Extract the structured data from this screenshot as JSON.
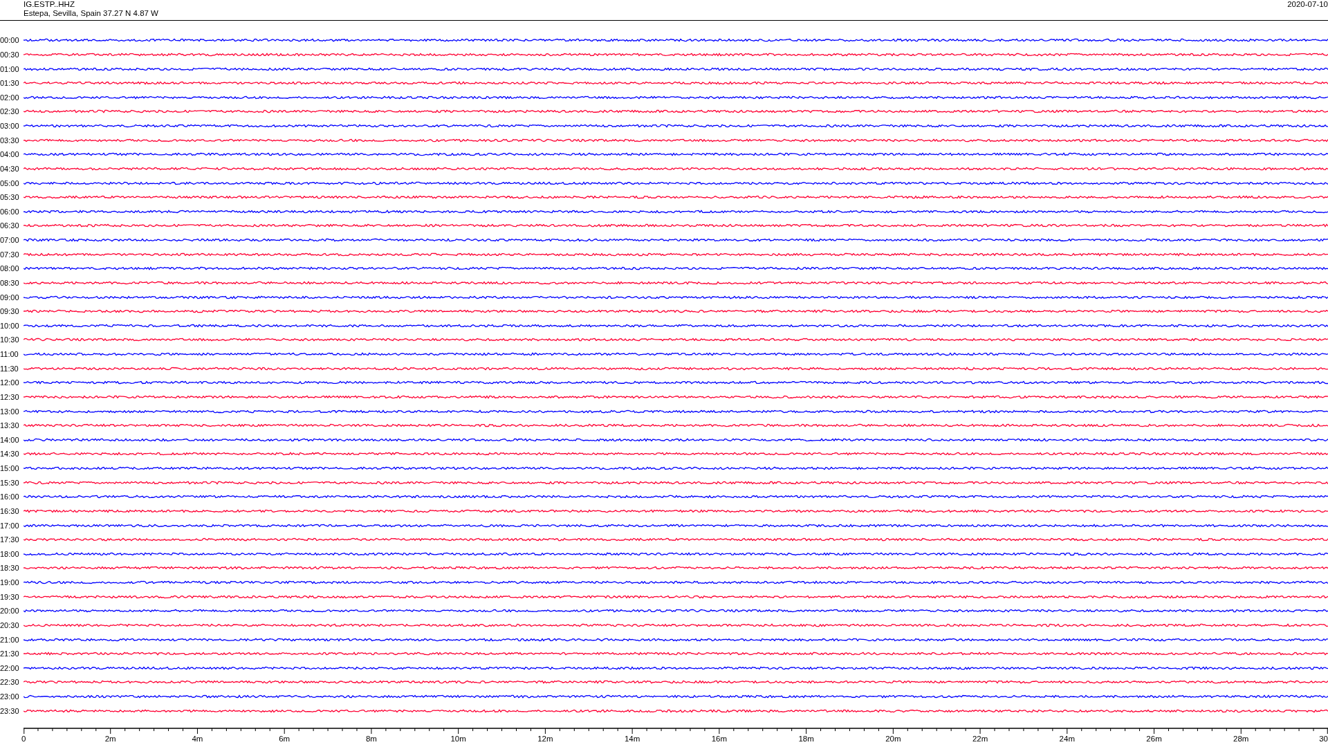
{
  "header": {
    "station": "IG.ESTP..HHZ",
    "location": "Estepa, Sevilla, Spain  37.27 N 4.87 W",
    "date": "2020-07-10"
  },
  "rows": [
    {
      "time": "00:00",
      "color": "#0000ff"
    },
    {
      "time": "00:30",
      "color": "#ff0033"
    },
    {
      "time": "01:00",
      "color": "#0000ff"
    },
    {
      "time": "01:30",
      "color": "#ff0033"
    },
    {
      "time": "02:00",
      "color": "#0000ff"
    },
    {
      "time": "02:30",
      "color": "#ff0033"
    },
    {
      "time": "03:00",
      "color": "#0000ff"
    },
    {
      "time": "03:30",
      "color": "#ff0033"
    },
    {
      "time": "04:00",
      "color": "#0000ff"
    },
    {
      "time": "04:30",
      "color": "#ff0033"
    },
    {
      "time": "05:00",
      "color": "#0000ff"
    },
    {
      "time": "05:30",
      "color": "#ff0033"
    },
    {
      "time": "06:00",
      "color": "#0000ff"
    },
    {
      "time": "06:30",
      "color": "#ff0033"
    },
    {
      "time": "07:00",
      "color": "#0000ff"
    },
    {
      "time": "07:30",
      "color": "#ff0033"
    },
    {
      "time": "08:00",
      "color": "#0000ff"
    },
    {
      "time": "08:30",
      "color": "#ff0033"
    },
    {
      "time": "09:00",
      "color": "#0000ff"
    },
    {
      "time": "09:30",
      "color": "#ff0033"
    },
    {
      "time": "10:00",
      "color": "#0000ff"
    },
    {
      "time": "10:30",
      "color": "#ff0033"
    },
    {
      "time": "11:00",
      "color": "#0000ff"
    },
    {
      "time": "11:30",
      "color": "#ff0033"
    },
    {
      "time": "12:00",
      "color": "#0000ff"
    },
    {
      "time": "12:30",
      "color": "#ff0033"
    },
    {
      "time": "13:00",
      "color": "#0000ff"
    },
    {
      "time": "13:30",
      "color": "#ff0033"
    },
    {
      "time": "14:00",
      "color": "#0000ff"
    },
    {
      "time": "14:30",
      "color": "#ff0033"
    },
    {
      "time": "15:00",
      "color": "#0000ff"
    },
    {
      "time": "15:30",
      "color": "#ff0033"
    },
    {
      "time": "16:00",
      "color": "#0000ff"
    },
    {
      "time": "16:30",
      "color": "#ff0033"
    },
    {
      "time": "17:00",
      "color": "#0000ff"
    },
    {
      "time": "17:30",
      "color": "#ff0033"
    },
    {
      "time": "18:00",
      "color": "#0000ff"
    },
    {
      "time": "18:30",
      "color": "#ff0033"
    },
    {
      "time": "19:00",
      "color": "#0000ff"
    },
    {
      "time": "19:30",
      "color": "#ff0033"
    },
    {
      "time": "20:00",
      "color": "#0000ff"
    },
    {
      "time": "20:30",
      "color": "#ff0033"
    },
    {
      "time": "21:00",
      "color": "#0000ff"
    },
    {
      "time": "21:30",
      "color": "#ff0033"
    },
    {
      "time": "22:00",
      "color": "#0000ff"
    },
    {
      "time": "22:30",
      "color": "#ff0033"
    },
    {
      "time": "23:00",
      "color": "#0000ff"
    },
    {
      "time": "23:30",
      "color": "#ff0033"
    }
  ],
  "axis": {
    "ticks": [
      "0",
      "2m",
      "4m",
      "6m",
      "8m",
      "10m",
      "12m",
      "14m",
      "16m",
      "18m",
      "20m",
      "22m",
      "24m",
      "26m",
      "28m",
      "30"
    ]
  }
}
